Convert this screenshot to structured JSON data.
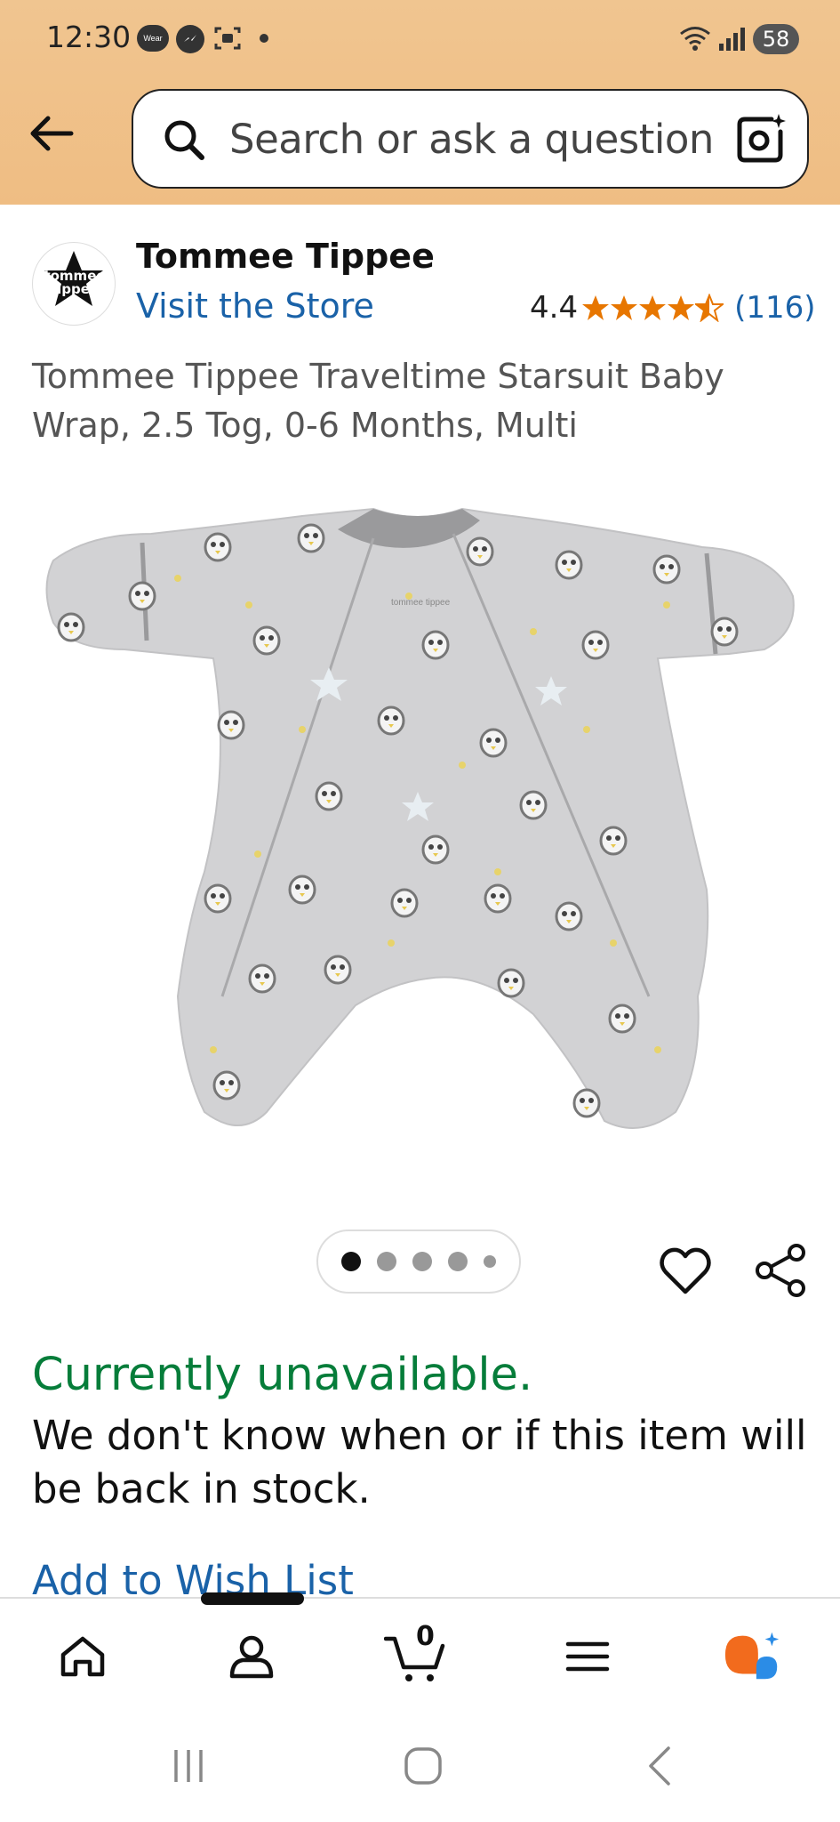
{
  "status_bar": {
    "time": "12:30",
    "wear_label": "Wear",
    "battery": "58"
  },
  "search": {
    "placeholder": "Search or ask a question"
  },
  "brand": {
    "logo_text_line1": "tommee",
    "logo_text_line2": "tippee",
    "name": "Tommee Tippee",
    "visit_store": "Visit the Store"
  },
  "rating": {
    "value": "4.4",
    "stars": 4.4,
    "count": "(116)"
  },
  "product": {
    "title": "Tommee Tippee Traveltime Starsuit Baby Wrap, 2.5 Tog, 0-6 Months, Multi",
    "image_label": "tommee tippee",
    "image_count": 5,
    "active_image": 1
  },
  "availability": {
    "status": "Currently unavailable.",
    "description": "We don't know when or if this item will be back in stock."
  },
  "actions": {
    "add_to_wishlist": "Add to Wish List"
  },
  "bottom_nav": {
    "cart_count": "0",
    "items": [
      "home-icon",
      "account-icon",
      "cart-icon",
      "menu-icon",
      "rufus-icon"
    ]
  },
  "colors": {
    "header_bg": "#efbd83",
    "link": "#1a62a8",
    "unavailable": "#067d3a",
    "star": "#e77600",
    "rufus_orange": "#f26b1d",
    "rufus_blue": "#2b8ce6"
  }
}
